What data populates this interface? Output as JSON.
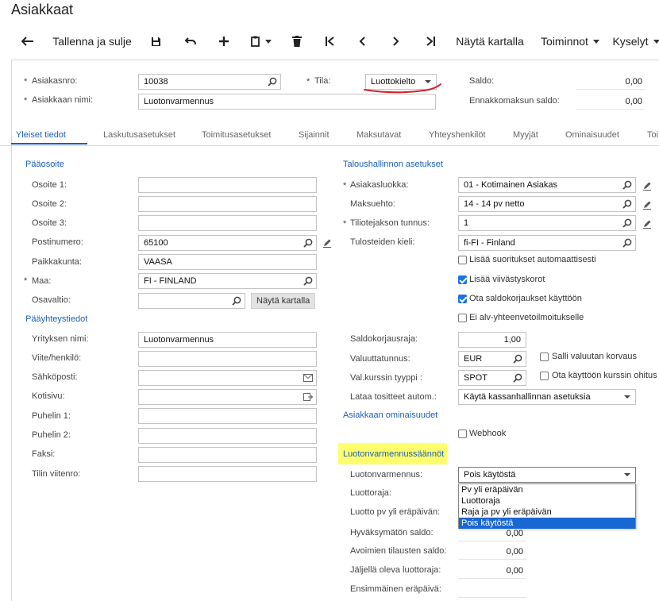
{
  "page": {
    "title": "Asiakkaat"
  },
  "toolbar": {
    "save_close": "Tallenna ja sulje",
    "show_map": "Näytä kartalla",
    "actions": "Toiminnot",
    "inquiries": "Kyselyt"
  },
  "header": {
    "customer_no_label": "Asiakasnro:",
    "customer_no": "10038",
    "customer_name_label": "Asiakkaan nimi:",
    "customer_name": "Luotonvarmennus",
    "status_label": "Tila:",
    "status": "Luottokielto",
    "balance_label": "Saldo:",
    "balance": "0,00",
    "prepay_label": "Ennakkomaksun saldo:",
    "prepay": "0,00"
  },
  "tabs": [
    "Yleiset tiedot",
    "Laskutusasetukset",
    "Toimitusasetukset",
    "Sijainnit",
    "Maksutavat",
    "Yhteyshenkilöt",
    "Myyjät",
    "Ominaisuudet",
    "Toi"
  ],
  "address": {
    "section": "Pääosoite",
    "addr1_label": "Osoite 1:",
    "addr1": "",
    "addr2_label": "Osoite 2:",
    "addr2": "",
    "addr3_label": "Osoite 3:",
    "addr3": "",
    "postal_label": "Postinumero:",
    "postal": "65100",
    "city_label": "Paikkakunta:",
    "city": "VAASA",
    "country_label": "Maa:",
    "country": "FI - FINLAND",
    "state_label": "Osavaltio:",
    "state": "",
    "show_map": "Näytä kartalla"
  },
  "contact": {
    "section": "Pääyhteystiedot",
    "company_label": "Yrityksen nimi:",
    "company": "Luotonvarmennus",
    "attention_label": "Viite/henkilö:",
    "attention": "",
    "email_label": "Sähköposti:",
    "email": "",
    "web_label": "Kotisivu:",
    "web": "",
    "phone1_label": "Puhelin 1:",
    "phone1": "",
    "phone2_label": "Puhelin 2:",
    "phone2": "",
    "fax_label": "Faksi:",
    "fax": "",
    "account_ref_label": "Tilin viitenro:",
    "account_ref": ""
  },
  "financial": {
    "section": "Taloushallinnon asetukset",
    "class_label": "Asiakasluokka:",
    "class": "01 - Kotimainen Asiakas",
    "terms_label": "Maksuehto:",
    "terms": "14 - 14 pv netto",
    "statement_label": "Tiliotejakson tunnus:",
    "statement": "1",
    "print_lang_label": "Tulosteiden kieli:",
    "print_lang": "fi-FI - Finland",
    "chk_apply_payments": "Lisää suoritukset automaattisesti",
    "chk_overdue": "Lisää viivästyskorot",
    "chk_writeoff": "Ota saldokorjaukset käyttöön",
    "chk_vat": "Ei alv-yhteenvetoilmoitukselle",
    "writeoff_limit_label": "Saldokorjausraja:",
    "writeoff_limit": "1,00",
    "currency_label": "Valuuttatunnus:",
    "currency": "EUR",
    "chk_currency_override": "Salli valuutan korvaus",
    "rate_type_label": "Val.kurssin tyyppi :",
    "rate_type": "SPOT",
    "chk_rate_override": "Ota käyttöön kurssin ohitus",
    "load_docs_label": "Lataa tositteet autom.:",
    "load_docs": "Käytä kassanhallinnan asetuksia"
  },
  "attributes": {
    "section": "Asiakkaan ominaisuudet",
    "chk_webhook": "Webhook"
  },
  "credit": {
    "section": "Luotonvarmennussäännöt",
    "verification_label": "Luotonvarmennus:",
    "verification": "Pois käytöstä",
    "options": [
      "Pv yli eräpäivän",
      "Luottoraja",
      "Raja ja pv yli eräpäivän",
      "Pois käytöstä"
    ],
    "limit_label": "Luottoraja:",
    "days_label": "Luotto pv yli eräpäivän:",
    "unreleased_label": "Hyväksymätön saldo:",
    "unreleased": "0,00",
    "open_orders_label": "Avoimien tilausten saldo:",
    "open_orders": "0,00",
    "remaining_label": "Jäljellä oleva luottoraja:",
    "remaining": "0,00",
    "first_due_label": "Ensimmäinen eräpäivä:"
  },
  "colors": {
    "accent": "#1a5fb4",
    "selected": "#1967d2",
    "highlight": "#ffff66",
    "annotation_red": "#d0202a"
  }
}
